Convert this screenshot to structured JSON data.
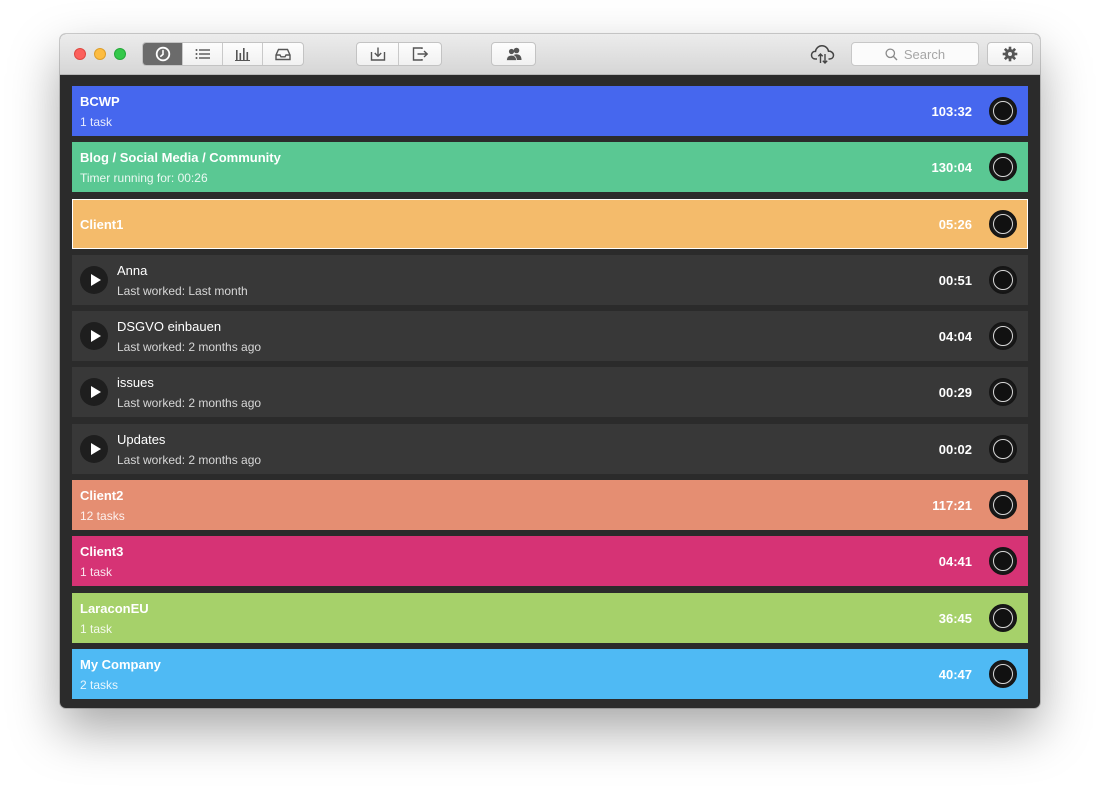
{
  "toolbar": {
    "view_buttons": [
      {
        "icon": "clock-icon",
        "active": true
      },
      {
        "icon": "list-icon",
        "active": false
      },
      {
        "icon": "bar-chart-icon",
        "active": false
      },
      {
        "icon": "inbox-icon",
        "active": false
      }
    ],
    "action_buttons": [
      {
        "icon": "import-icon"
      },
      {
        "icon": "export-icon"
      }
    ],
    "team_button_icon": "users-icon",
    "sync_icon": "cloud-sync-icon",
    "search_placeholder": "Search",
    "settings_icon": "gear-icon"
  },
  "rows": [
    {
      "kind": "project",
      "title": "BCWP",
      "subtitle": "1 task",
      "time": "103:32",
      "color": "#4667ee"
    },
    {
      "kind": "project",
      "title": "Blog / Social Media / Community",
      "subtitle": "Timer running for: 00:26",
      "time": "130:04",
      "color": "#5ac893"
    },
    {
      "kind": "project",
      "title": "Client1",
      "subtitle": "",
      "time": "05:26",
      "color": "#f4bb6b",
      "selected": true
    },
    {
      "kind": "task",
      "title": "Anna",
      "subtitle": "Last worked: Last month",
      "time": "00:51"
    },
    {
      "kind": "task",
      "title": "DSGVO einbauen",
      "subtitle": "Last worked: 2 months ago",
      "time": "04:04"
    },
    {
      "kind": "task",
      "title": "issues",
      "subtitle": "Last worked: 2 months ago",
      "time": "00:29"
    },
    {
      "kind": "task",
      "title": "Updates",
      "subtitle": "Last worked: 2 months ago",
      "time": "00:02"
    },
    {
      "kind": "project",
      "title": "Client2",
      "subtitle": "12 tasks",
      "time": "117:21",
      "color": "#e58e72"
    },
    {
      "kind": "project",
      "title": "Client3",
      "subtitle": "1 task",
      "time": "04:41",
      "color": "#d63375"
    },
    {
      "kind": "project",
      "title": "LaraconEU",
      "subtitle": "1 task",
      "time": "36:45",
      "color": "#a6d16a"
    },
    {
      "kind": "project",
      "title": "My Company",
      "subtitle": "2 tasks",
      "time": "40:47",
      "color": "#4fbaf4"
    }
  ]
}
